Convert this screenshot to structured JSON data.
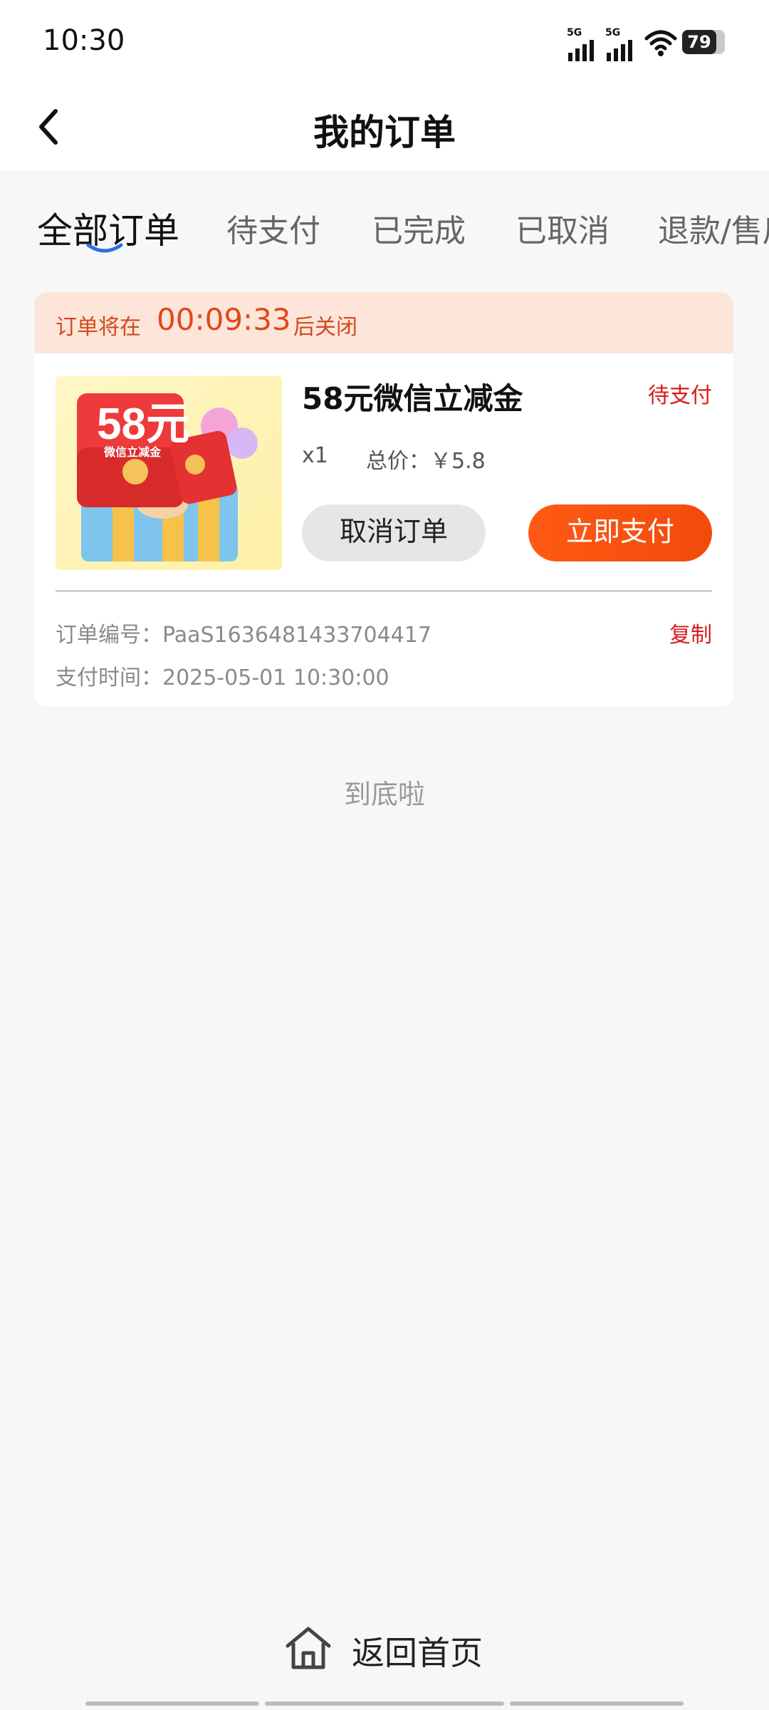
{
  "status_bar": {
    "time": "10:30",
    "network_1": "5G",
    "network_2": "5G",
    "battery": "79"
  },
  "header": {
    "title": "我的订单"
  },
  "tabs": [
    {
      "label": "全部订单",
      "active": true
    },
    {
      "label": "待支付",
      "active": false
    },
    {
      "label": "已完成",
      "active": false
    },
    {
      "label": "已取消",
      "active": false
    },
    {
      "label": "退款/售后",
      "active": false
    }
  ],
  "order": {
    "countdown_prefix": "订单将在",
    "countdown_time": "00:09:33",
    "countdown_suffix": "后关闭",
    "product_image_text": "58元",
    "product_image_subtext": "微信立减金",
    "product_name": "58元微信立减金",
    "status": "待支付",
    "quantity": "x1",
    "total_price": "总价：￥5.8",
    "cancel_label": "取消订单",
    "pay_label": "立即支付",
    "order_number": "订单编号：PaaS1636481433704417",
    "copy_label": "复制",
    "payment_time": "支付时间：2025-05-01 10:30:00"
  },
  "list_end_text": "到底啦",
  "footer": {
    "home_label": "返回首页"
  },
  "colors": {
    "accent": "#f24a0c",
    "status_red": "#d71b1b",
    "countdown_bg": "#fde5da",
    "page_bg": "#f7f7f7"
  }
}
